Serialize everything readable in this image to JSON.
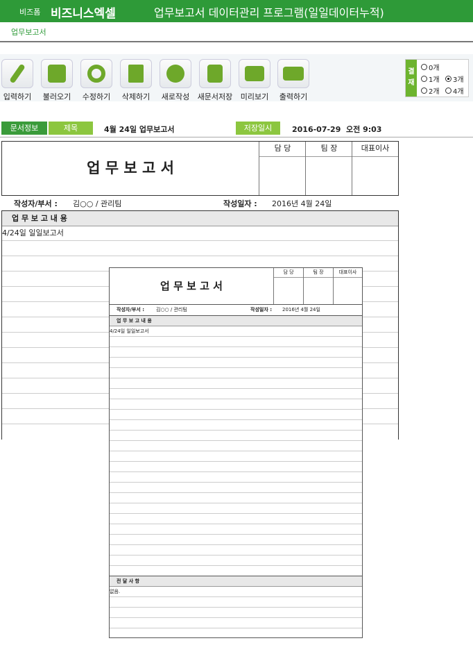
{
  "header": {
    "brand_small": "비즈폼",
    "brand": "비즈니스엑셀",
    "title": "업무보고서 데이터관리 프로그램(일일데이터누적)"
  },
  "subnav": {
    "label": "업무보고서"
  },
  "toolbar": [
    {
      "label": "입력하기",
      "icon": "pencil-icon"
    },
    {
      "label": "불러오기",
      "icon": "load-icon"
    },
    {
      "label": "수정하기",
      "icon": "refresh-icon"
    },
    {
      "label": "삭제하기",
      "icon": "trash-icon"
    },
    {
      "label": "새로작성",
      "icon": "new-icon"
    },
    {
      "label": "새문서저장",
      "icon": "save-icon"
    },
    {
      "label": "미리보기",
      "icon": "monitor-icon"
    },
    {
      "label": "출력하기",
      "icon": "print-icon"
    }
  ],
  "approval": {
    "label": "결재",
    "options": [
      "0개",
      "1개",
      "2개",
      "3개",
      "4개"
    ],
    "selected": "3개"
  },
  "info": {
    "doc_info": "문서정보",
    "title_label": "제목",
    "title_value": "4월 24일 업무보고서",
    "saved_label": "저장일시",
    "saved_value": "2016-07-29  오전 9:03"
  },
  "doc": {
    "title": "업 무 보 고 서",
    "sign": [
      "담 당",
      "팀 장",
      "대표이사"
    ],
    "author_label": "작성자/부서 :",
    "author_value": "김○○ / 관리팀",
    "date_label": "작성일자 :",
    "date_value": "2016년 4월 24일",
    "content_header": "업 무 보 고 내 용",
    "content_first": "4/24일 일일보고서",
    "notes_header": "전 달 사 항",
    "notes_first": "없음."
  }
}
